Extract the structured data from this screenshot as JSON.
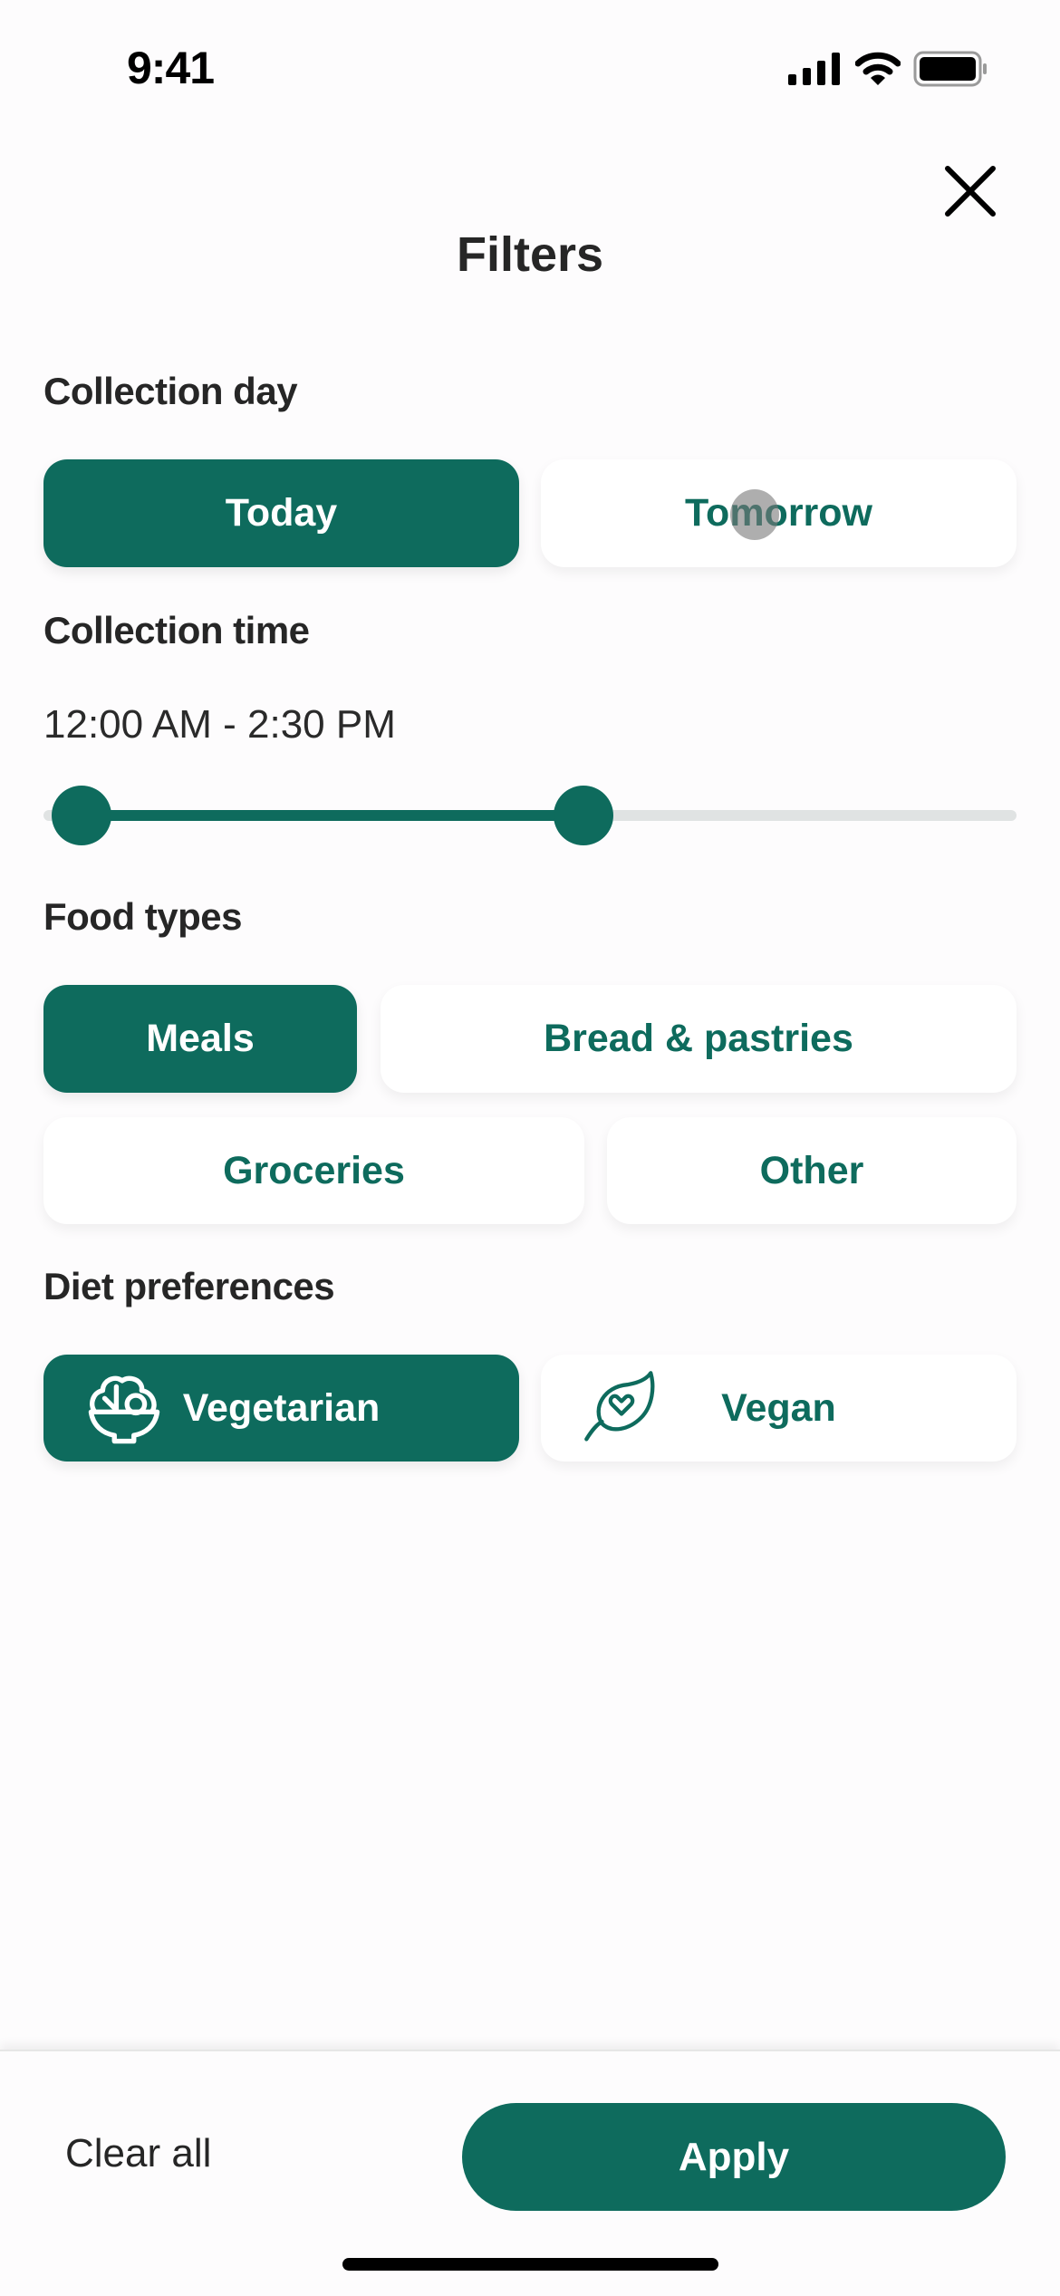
{
  "status_bar": {
    "time": "9:41",
    "icons": [
      "cellular-signal-icon",
      "wifi-icon",
      "battery-icon"
    ]
  },
  "header": {
    "title": "Filters",
    "close_icon": "close-icon"
  },
  "collection_day": {
    "label": "Collection day",
    "options": [
      {
        "label": "Today",
        "selected": true
      },
      {
        "label": "Tomorrow",
        "selected": false
      }
    ]
  },
  "collection_time": {
    "label": "Collection time",
    "range_text": "12:00 AM - 2:30 PM",
    "slider": {
      "min_fraction": 0.0,
      "max_fraction": 0.56
    }
  },
  "food_types": {
    "label": "Food types",
    "options": [
      {
        "label": "Meals",
        "selected": true
      },
      {
        "label": "Bread & pastries",
        "selected": false
      },
      {
        "label": "Groceries",
        "selected": false
      },
      {
        "label": "Other",
        "selected": false
      }
    ]
  },
  "diet_preferences": {
    "label": "Diet preferences",
    "options": [
      {
        "label": "Vegetarian",
        "icon": "salad-bowl-icon",
        "selected": true
      },
      {
        "label": "Vegan",
        "icon": "leaf-heart-icon",
        "selected": false
      }
    ]
  },
  "footer": {
    "clear_label": "Clear all",
    "apply_label": "Apply"
  },
  "colors": {
    "accent": "#0e6b5d",
    "chip_bg": "#ffffff",
    "page_bg": "#fdfcfd",
    "text": "#262626",
    "track": "#e0e3e3"
  }
}
